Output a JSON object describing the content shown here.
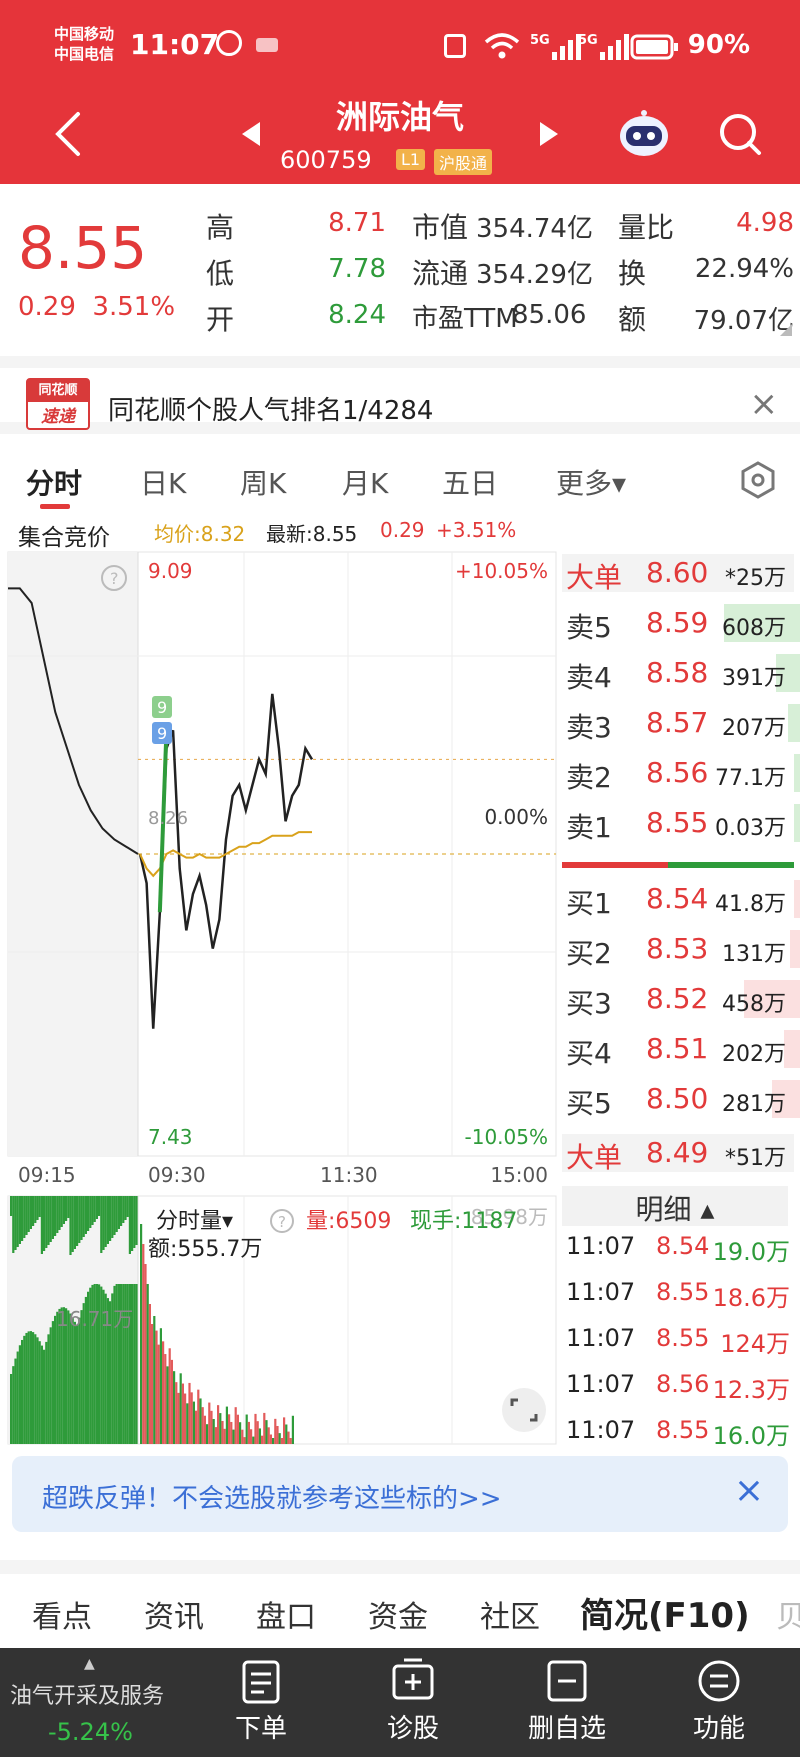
{
  "status_bar": {
    "carrier_1": "中国移动",
    "carrier_2": "中国电信",
    "time": "11:07",
    "signal_text": "5G 5G",
    "battery": "90%"
  },
  "header": {
    "title": "洲际油气",
    "code": "600759",
    "badge_l1": "L1",
    "badge_connect": "沪股通"
  },
  "quote": {
    "price": "8.55",
    "change": "0.29",
    "change_pct": "3.51%",
    "high_label": "高",
    "high": "8.71",
    "low_label": "低",
    "low": "7.78",
    "open_label": "开",
    "open": "8.24",
    "mktcap_label": "市值",
    "mktcap": "354.74亿",
    "float_label": "流通",
    "float": "354.29亿",
    "pe_label": "市盈TTM",
    "pe": "85.06",
    "volratio_label": "量比",
    "volratio": "4.98",
    "turnover_label": "换",
    "turnover": "22.94%",
    "amount_label": "额",
    "amount": "79.07亿"
  },
  "ranking": {
    "logo_top": "同花顺",
    "logo_bottom": "速递",
    "text": "同花顺个股人气排名1/4284"
  },
  "tabs": [
    "分时",
    "日K",
    "周K",
    "月K",
    "五日",
    "更多▾"
  ],
  "summary": {
    "auction": "集合竞价",
    "avg": "均价:8.32",
    "latest": "最新:8.55",
    "change": "0.29",
    "change_pct": "+3.51%"
  },
  "chart_data": {
    "type": "line",
    "x_labels": [
      "09:15",
      "09:30",
      "11:30",
      "15:00"
    ],
    "y_top": "9.09",
    "y_bottom": "7.43",
    "pct_top": "+10.05%",
    "pct_mid": "0.00%",
    "pct_bottom": "-10.05%",
    "ylim": [
      7.43,
      9.09
    ],
    "reference_price": 8.26,
    "price_series": [
      8.26,
      8.18,
      7.78,
      8.1,
      8.55,
      8.6,
      8.22,
      8.05,
      8.15,
      8.2,
      8.12,
      8.0,
      8.08,
      8.3,
      8.42,
      8.45,
      8.38,
      8.45,
      8.52,
      8.48,
      8.7,
      8.55,
      8.35,
      8.42,
      8.45,
      8.55,
      8.52
    ],
    "avg_series": [
      8.26,
      8.22,
      8.2,
      8.22,
      8.26,
      8.27,
      8.26,
      8.25,
      8.25,
      8.26,
      8.25,
      8.25,
      8.25,
      8.26,
      8.27,
      8.28,
      8.28,
      8.29,
      8.29,
      8.3,
      8.31,
      8.31,
      8.31,
      8.31,
      8.32,
      8.32,
      8.32
    ],
    "marker_labels": [
      "9",
      "9"
    ],
    "mid_label": "8.26"
  },
  "volume_panel": {
    "title": "分时量▾",
    "vol_label": "量:6509",
    "hand_label": "现手:1187",
    "amount_label": "额:555.7万",
    "max_label": "85.98万",
    "auction_label": "16.71万"
  },
  "order_book": {
    "big_sell": {
      "label": "大单",
      "price": "8.60",
      "vol": "*25万"
    },
    "asks": [
      {
        "label": "卖5",
        "price": "8.59",
        "vol": "608万",
        "fill": 0.95
      },
      {
        "label": "卖4",
        "price": "8.58",
        "vol": "391万",
        "fill": 0.3
      },
      {
        "label": "卖3",
        "price": "8.57",
        "vol": "207万",
        "fill": 0.15
      },
      {
        "label": "卖2",
        "price": "8.56",
        "vol": "77.1万",
        "fill": 0.08
      },
      {
        "label": "卖1",
        "price": "8.55",
        "vol": "0.03万",
        "fill": 0.02
      }
    ],
    "bids": [
      {
        "label": "买1",
        "price": "8.54",
        "vol": "41.8万",
        "fill": 0.05
      },
      {
        "label": "买2",
        "price": "8.53",
        "vol": "131万",
        "fill": 0.12
      },
      {
        "label": "买3",
        "price": "8.52",
        "vol": "458万",
        "fill": 0.7
      },
      {
        "label": "买4",
        "price": "8.51",
        "vol": "202万",
        "fill": 0.2
      },
      {
        "label": "买5",
        "price": "8.50",
        "vol": "281万",
        "fill": 0.35
      }
    ],
    "big_buy": {
      "label": "大单",
      "price": "8.49",
      "vol": "*51万"
    }
  },
  "details": {
    "header": "明细 ▴",
    "rows": [
      {
        "time": "11:07",
        "price": "8.54",
        "vol": "19.0万",
        "dir": "green"
      },
      {
        "time": "11:07",
        "price": "8.55",
        "vol": "18.6万",
        "dir": "red"
      },
      {
        "time": "11:07",
        "price": "8.55",
        "vol": "124万",
        "dir": "red"
      },
      {
        "time": "11:07",
        "price": "8.56",
        "vol": "12.3万",
        "dir": "red"
      },
      {
        "time": "11:07",
        "price": "8.55",
        "vol": "16.0万",
        "dir": "green"
      }
    ]
  },
  "promo": {
    "text": "超跌反弹！不会选股就参考这些标的>>"
  },
  "bottom_tabs": [
    "看点",
    "资讯",
    "盘口",
    "资金",
    "社区",
    "简况(F10)",
    "贝"
  ],
  "bottom_nav": {
    "sector": "油气开采及服务",
    "sector_pct": "-5.24%",
    "items": [
      "下单",
      "诊股",
      "删自选",
      "功能"
    ]
  }
}
